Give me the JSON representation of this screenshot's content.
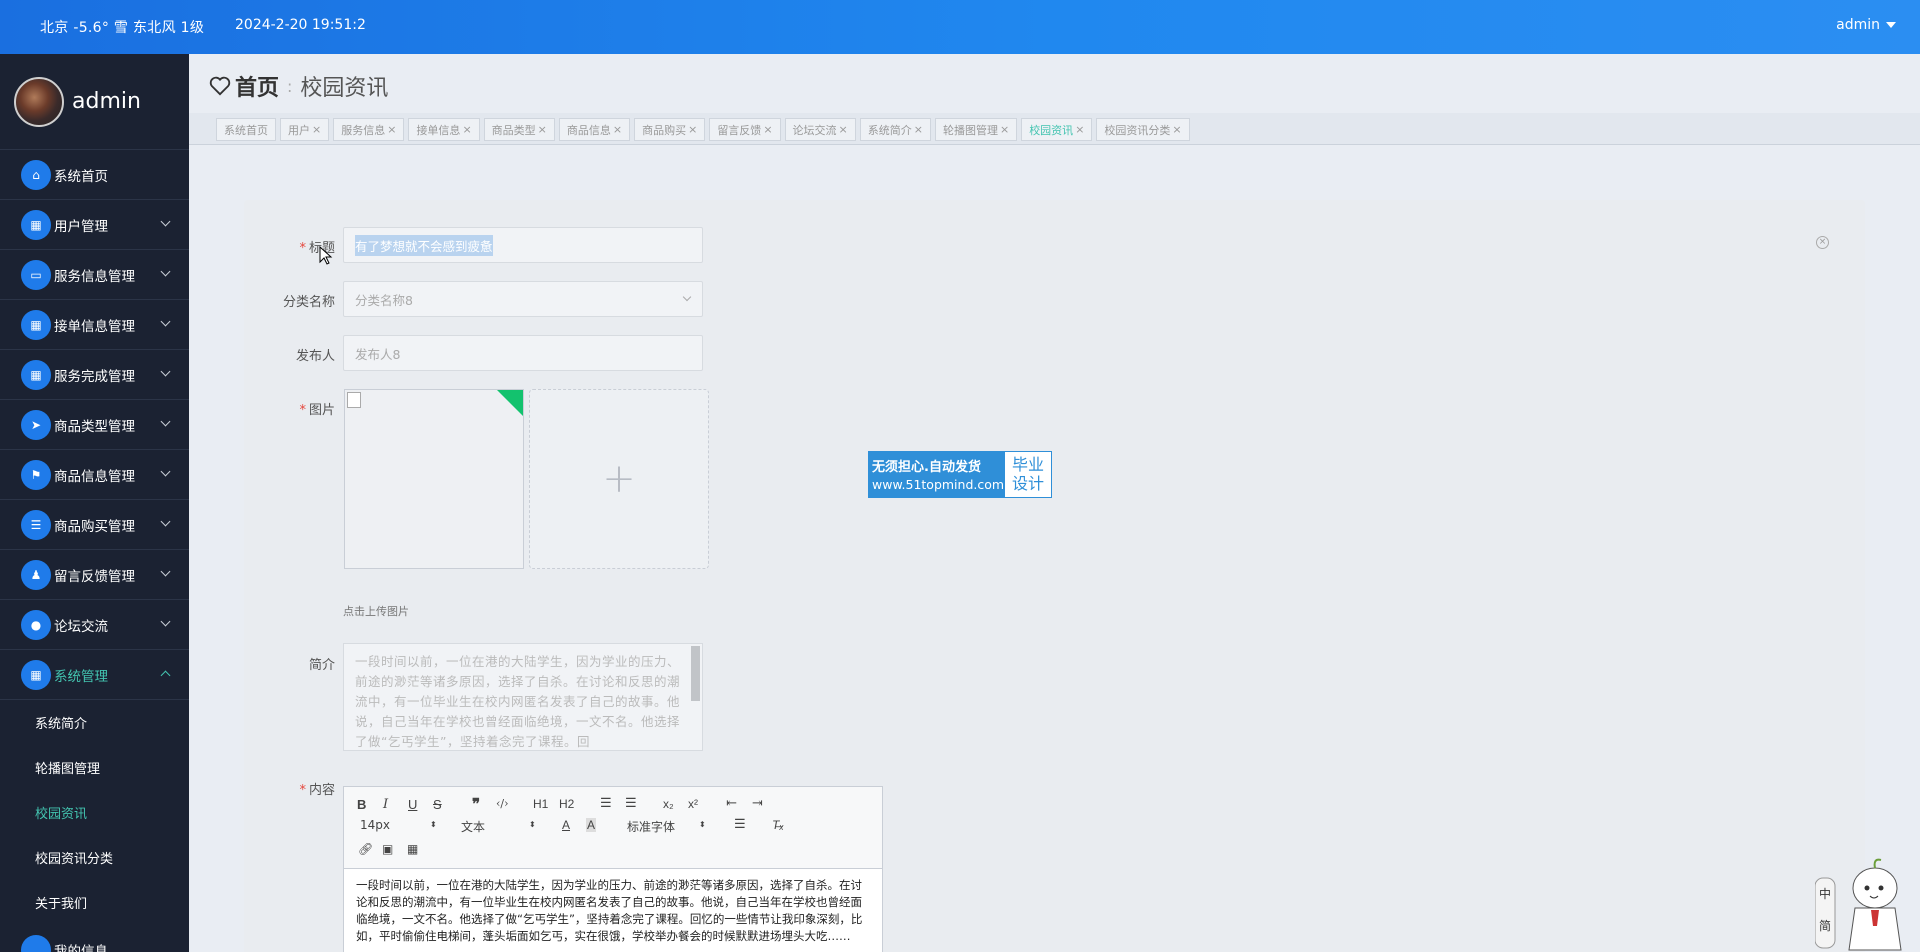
{
  "topbar": {
    "weather": "北京  -5.6°  雪  东北风  1级",
    "datetime": "2024-2-20 19:51:2",
    "user": "admin"
  },
  "sidebar": {
    "username": "admin",
    "items": [
      {
        "label": "系统首页",
        "icon": "home-icon",
        "expandable": false
      },
      {
        "label": "用户管理",
        "icon": "grid-icon",
        "expandable": true
      },
      {
        "label": "服务信息管理",
        "icon": "monitor-icon",
        "expandable": true
      },
      {
        "label": "接单信息管理",
        "icon": "grid-icon",
        "expandable": true
      },
      {
        "label": "服务完成管理",
        "icon": "grid-icon",
        "expandable": true
      },
      {
        "label": "商品类型管理",
        "icon": "send-icon",
        "expandable": true
      },
      {
        "label": "商品信息管理",
        "icon": "flag-icon",
        "expandable": true
      },
      {
        "label": "商品购买管理",
        "icon": "list-icon",
        "expandable": true
      },
      {
        "label": "留言反馈管理",
        "icon": "user-icon",
        "expandable": true
      },
      {
        "label": "论坛交流",
        "icon": "location-icon",
        "expandable": true
      },
      {
        "label": "系统管理",
        "icon": "grid-icon",
        "expandable": true,
        "active": true
      }
    ],
    "submenu": [
      {
        "label": "系统简介"
      },
      {
        "label": "轮播图管理"
      },
      {
        "label": "校园资讯",
        "active": true
      },
      {
        "label": "校园资讯分类"
      },
      {
        "label": "关于我们"
      }
    ],
    "partial_next": "我的信息"
  },
  "breadcrumb": {
    "home": "首页",
    "current": "校园资讯"
  },
  "tabs": [
    {
      "label": "系统首页",
      "closable": false
    },
    {
      "label": "用户",
      "closable": true
    },
    {
      "label": "服务信息",
      "closable": true
    },
    {
      "label": "接单信息",
      "closable": true
    },
    {
      "label": "商品类型",
      "closable": true
    },
    {
      "label": "商品信息",
      "closable": true
    },
    {
      "label": "商品购买",
      "closable": true
    },
    {
      "label": "留言反馈",
      "closable": true
    },
    {
      "label": "论坛交流",
      "closable": true
    },
    {
      "label": "系统简介",
      "closable": true
    },
    {
      "label": "轮播图管理",
      "closable": true
    },
    {
      "label": "校园资讯",
      "closable": true,
      "active": true
    },
    {
      "label": "校园资讯分类",
      "closable": true
    }
  ],
  "close_symbol": "×",
  "form": {
    "title_label": "标题",
    "title_value": "有了梦想就不会感到疲惫",
    "category_label": "分类名称",
    "category_value": "分类名称8",
    "publisher_label": "发布人",
    "publisher_value": "发布人8",
    "image_label": "图片",
    "upload_hint": "点击上传图片",
    "upload_plus": "+",
    "summary_label": "简介",
    "summary_value": "一段时间以前，一位在港的大陆学生，因为学业的压力、前途的渺茫等诸多原因，选择了自杀。在讨论和反思的潮流中，有一位毕业生在校内网匿名发表了自己的故事。他说，自己当年在学校也曾经面临绝境，一文不名。他选择了做“乞丐学生”，坚持着念完了课程。回",
    "content_label": "内容",
    "required_mark": "*"
  },
  "editor": {
    "font_size": "14px",
    "header_select": "文本",
    "font_family": "标准字体",
    "buttons": [
      "B",
      "I",
      "U",
      "S",
      "99",
      "<>",
      "H1",
      "H2",
      "ol",
      "ul",
      "x2",
      "x²",
      "outdent",
      "indent"
    ],
    "content": "一段时间以前，一位在港的大陆学生，因为学业的压力、前途的渺茫等诸多原因，选择了自杀。在讨论和反思的潮流中，有一位毕业生在校内网匿名发表了自己的故事。他说，自己当年在学校也曾经面临绝境，一文不名。他选择了做“乞丐学生”，坚持着念完了课程。回忆的一些情节让我印象深刻，比如，平时偷偷住电梯间，蓬头垢面如乞丐，实在很饿，学校举办餐会的时候默默进场埋头大吃……"
  },
  "watermark": {
    "line1": "无须担心.自动发货",
    "line2": "www.51topmind.com",
    "side": "毕业设计"
  },
  "colors": {
    "topbar": "#1f80ec",
    "sidebar": "#1b2232",
    "accent": "#43c4b0",
    "icon_bg": "#1f7bea",
    "required": "#e5453b"
  }
}
